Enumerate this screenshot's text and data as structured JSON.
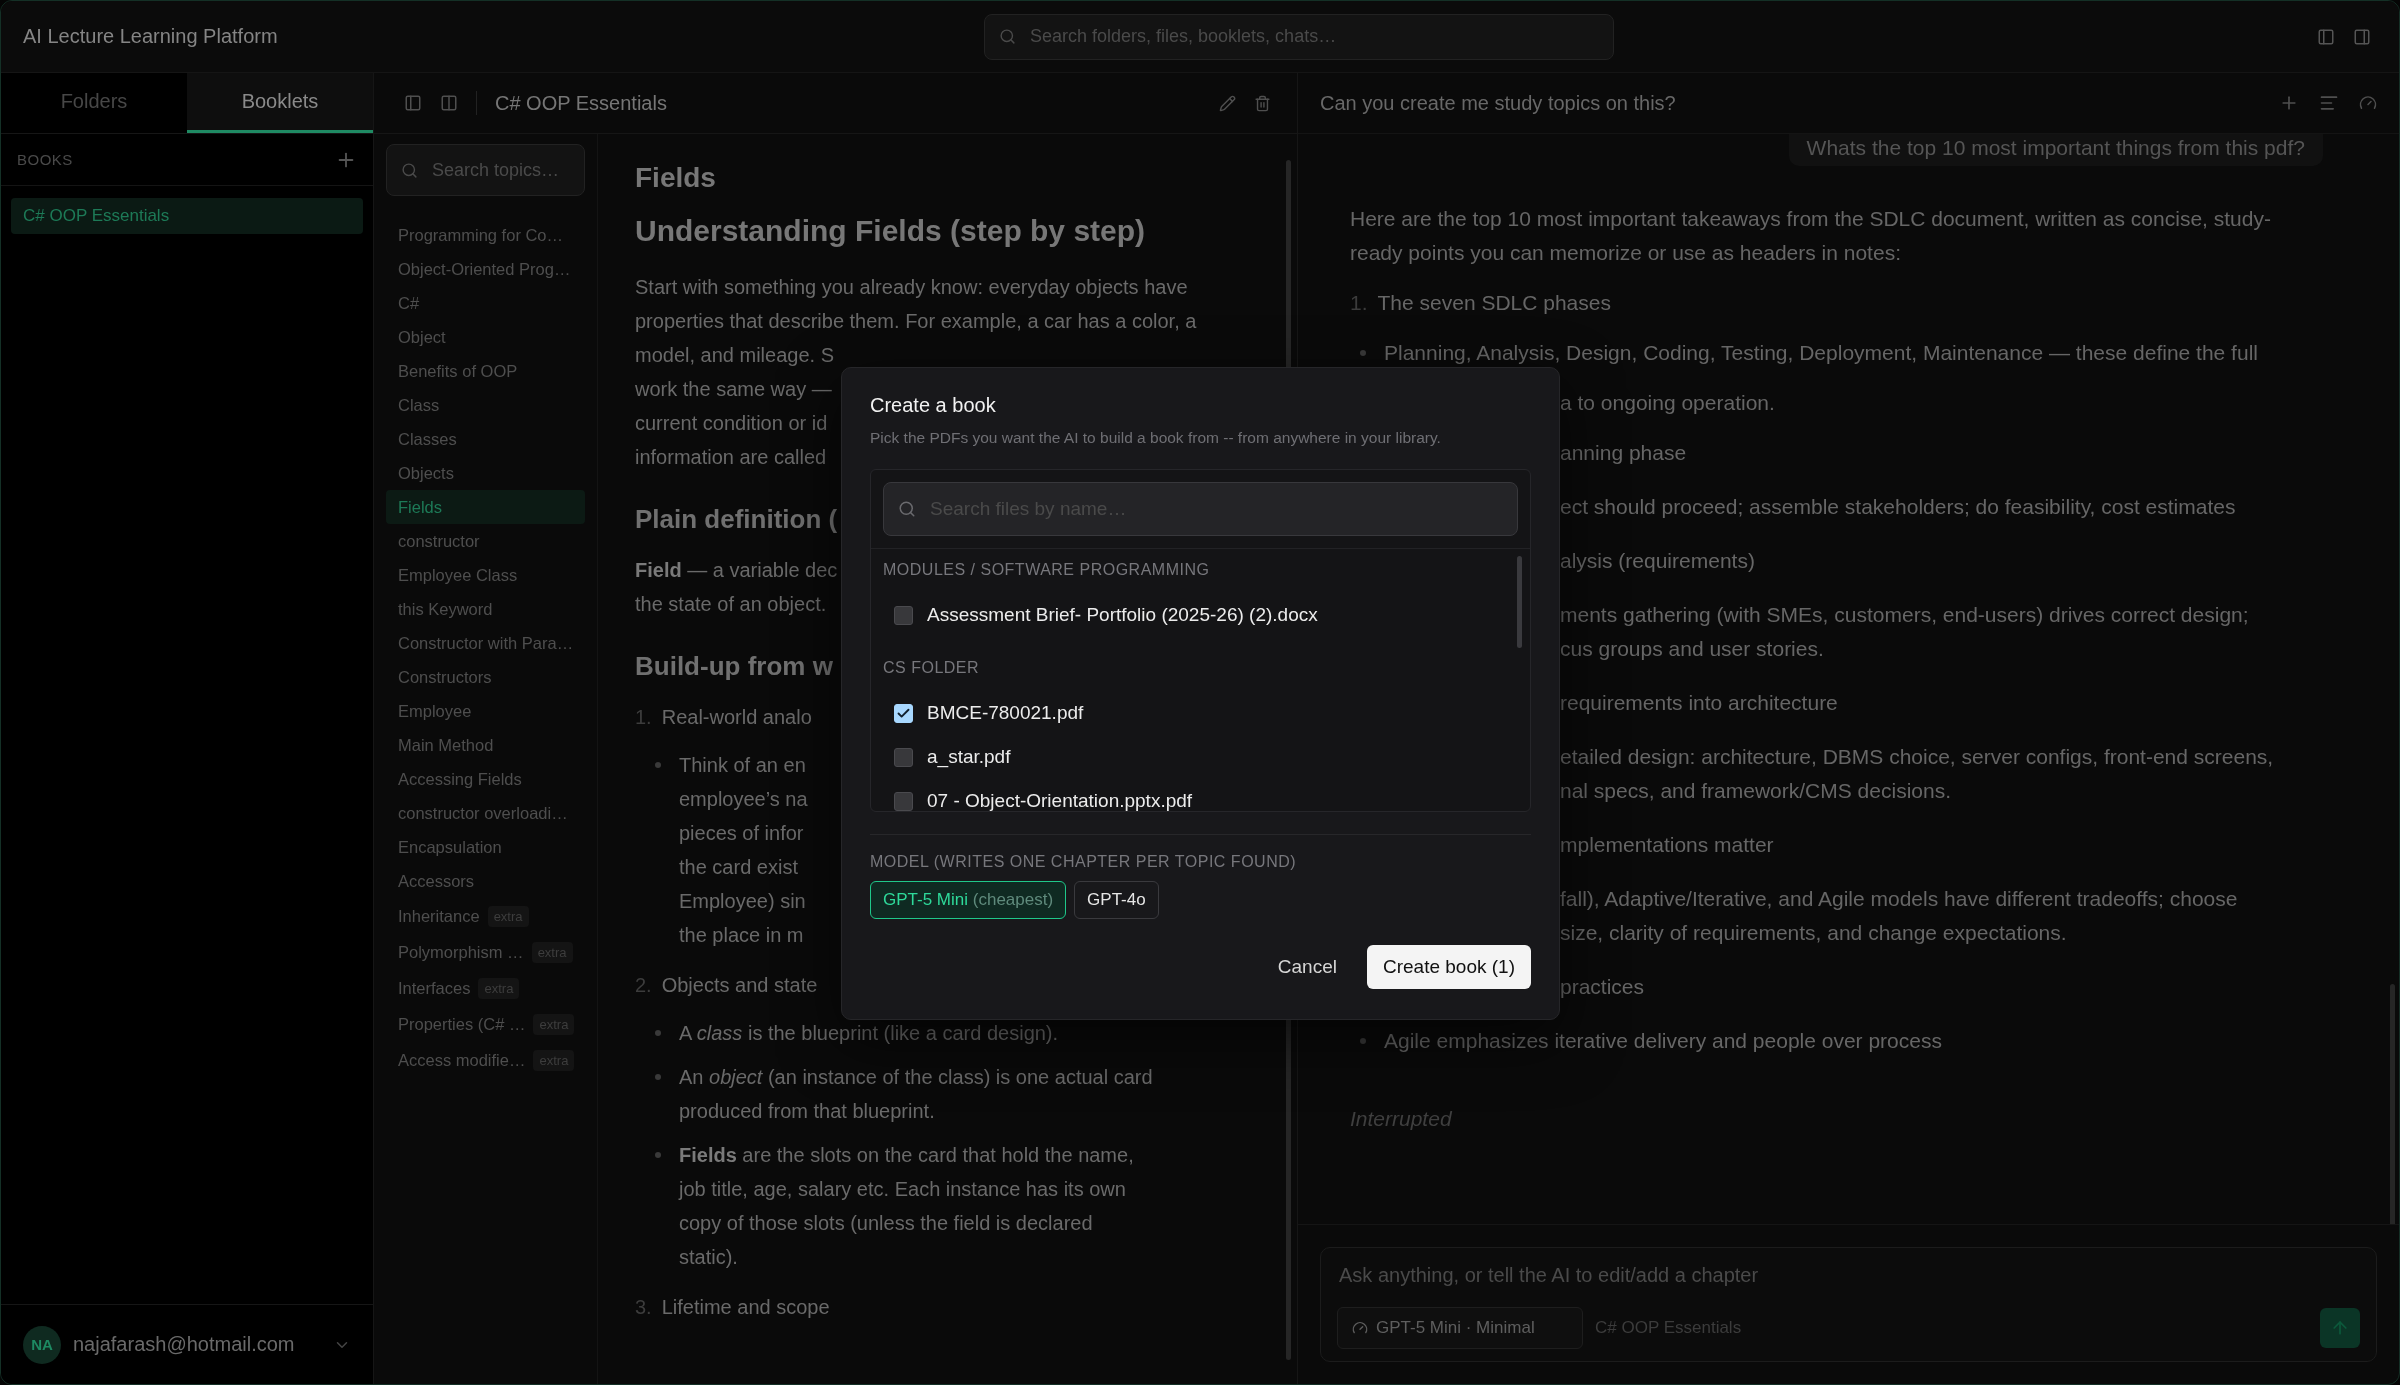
{
  "app": {
    "title": "AI Lecture Learning Platform",
    "search_placeholder": "Search folders, files, booklets, chats…"
  },
  "sidebar": {
    "tabs": [
      {
        "label": "Folders",
        "selected": false
      },
      {
        "label": "Booklets",
        "selected": true
      }
    ],
    "section": "BOOKS",
    "books": [
      {
        "title": "C# OOP Essentials",
        "selected": true
      }
    ],
    "user": {
      "initials": "NA",
      "email": "najafarash@hotmail.com"
    }
  },
  "booklet": {
    "title": "C# OOP Essentials",
    "topic_search_placeholder": "Search topics…",
    "topics": [
      {
        "label": "Programming for Co…",
        "selected": false
      },
      {
        "label": "Object-Oriented Prog…",
        "selected": false
      },
      {
        "label": "C#",
        "selected": false
      },
      {
        "label": "Object",
        "selected": false
      },
      {
        "label": "Benefits of OOP",
        "selected": false
      },
      {
        "label": "Class",
        "selected": false
      },
      {
        "label": "Classes",
        "selected": false
      },
      {
        "label": "Objects",
        "selected": false
      },
      {
        "label": "Fields",
        "selected": true
      },
      {
        "label": "constructor",
        "selected": false
      },
      {
        "label": "Employee Class",
        "selected": false
      },
      {
        "label": "this Keyword",
        "selected": false
      },
      {
        "label": "Constructor with Para…",
        "selected": false
      },
      {
        "label": "Constructors",
        "selected": false
      },
      {
        "label": "Employee",
        "selected": false
      },
      {
        "label": "Main Method",
        "selected": false
      },
      {
        "label": "Accessing Fields",
        "selected": false
      },
      {
        "label": "constructor overloadi…",
        "selected": false
      },
      {
        "label": "Encapsulation",
        "selected": false
      },
      {
        "label": "Accessors",
        "selected": false
      },
      {
        "label": "Inheritance",
        "selected": false,
        "badge": "extra"
      },
      {
        "label": "Polymorphism …",
        "selected": false,
        "badge": "extra"
      },
      {
        "label": "Interfaces",
        "selected": false,
        "badge": "extra"
      },
      {
        "label": "Properties (C# …",
        "selected": false,
        "badge": "extra"
      },
      {
        "label": "Access modifie…",
        "selected": false,
        "badge": "extra"
      }
    ],
    "blocks": [
      {
        "kind": "title",
        "text": "Fields"
      },
      {
        "kind": "h1",
        "text": "Understanding Fields (step by step)"
      },
      {
        "kind": "para",
        "lines": [
          "Start with something you already know: everyday objects have",
          "properties that describe them. For example, a car has a color, a"
        ]
      },
      {
        "kind": "para",
        "lines": [
          "model, and mileage. S",
          "work the same way —",
          "current condition or id",
          "information are called"
        ]
      },
      {
        "kind": "h2",
        "text": "Plain definition ("
      },
      {
        "kind": "para",
        "lines": [
          "**Field** — a variable dec",
          "the state of an object."
        ]
      },
      {
        "kind": "h2",
        "text": "Build-up from w"
      },
      {
        "kind": "item",
        "number": "1.",
        "text": "Real-world analo"
      },
      {
        "kind": "bullet",
        "lines": [
          "Think of an en",
          "employee’s na",
          "pieces of infor",
          "the card exist",
          "Employee) sin",
          "the place in m"
        ]
      },
      {
        "kind": "item",
        "number": "2.",
        "text": "Objects and state"
      },
      {
        "kind": "bullet",
        "lines": [
          "A *class* is the blueprint (like a card design)."
        ]
      },
      {
        "kind": "bullet",
        "lines": [
          "An *object* (an instance of the class) is one actual card",
          "produced from that blueprint."
        ]
      },
      {
        "kind": "bullet",
        "lines": [
          "**Fields** are the slots on the card that hold the name,",
          "job title, age, salary etc. Each instance has its own",
          "copy of those slots (unless the field is declared",
          "static)."
        ]
      },
      {
        "kind": "item",
        "number": "3.",
        "text": "Lifetime and scope"
      }
    ]
  },
  "chat": {
    "title": "Can you create me study topics on this?",
    "messages": [
      {
        "kind": "user",
        "lines": [
          "Whats the top 10 most important things from this pdf?"
        ]
      },
      {
        "kind": "para",
        "lines": [
          "Here are the top 10 most important takeaways from the SDLC document, written as concise, study-",
          "ready points you can memorize or use as headers in notes:"
        ]
      },
      {
        "kind": "item",
        "number": "1.",
        "lines": [
          "The seven SDLC phases"
        ]
      },
      {
        "kind": "bullet",
        "lines": [
          "Planning, Analysis, Design, Coding, Testing, Deployment, Maintenance — these define the full"
        ]
      },
      {
        "kind": "wrap",
        "lines": [
          "a to ongoing operation."
        ]
      },
      {
        "kind": "fragment",
        "lines": [
          "anning phase"
        ]
      },
      {
        "kind": "fragment",
        "lines": [
          "ect should proceed; assemble stakeholders; do feasibility, cost estimates"
        ]
      },
      {
        "kind": "fragment",
        "lines": [
          "alysis (requirements)"
        ]
      },
      {
        "kind": "fragment",
        "lines": [
          "ments gathering (with SMEs, customers, end-users) drives correct design;",
          "cus groups and user stories."
        ]
      },
      {
        "kind": "fragment",
        "lines": [
          "requirements into architecture"
        ]
      },
      {
        "kind": "fragment",
        "lines": [
          "etailed design: architecture, DBMS choice, server configs, front-end screens,",
          "nal specs, and framework/CMS decisions."
        ]
      },
      {
        "kind": "fragment",
        "lines": [
          "mplementations matter"
        ]
      },
      {
        "kind": "fragment",
        "lines": [
          "fall), Adaptive/Iterative, and Agile models have different tradeoffs; choose",
          "size, clarity of requirements, and change expectations."
        ]
      },
      {
        "kind": "fragment",
        "lines": [
          "practices"
        ]
      },
      {
        "kind": "bullet",
        "lines": [
          "Agile emphasizes iterative delivery and people over process"
        ]
      },
      {
        "kind": "note",
        "lines": [
          "Interrupted"
        ]
      }
    ],
    "input_placeholder": "Ask anything, or tell the AI to edit/add a chapter",
    "model": "GPT-5 Mini · Minimal",
    "context": "C# OOP Essentials"
  },
  "modal": {
    "title": "Create a book",
    "description": "Pick the PDFs you want the AI to build a book from -- from anywhere in your library.",
    "search_placeholder": "Search files by name…",
    "groups": [
      {
        "name": "MODULES / SOFTWARE PROGRAMMING",
        "files": [
          {
            "name": "Assessment Brief- Portfolio (2025-26) (2).docx",
            "checked": false
          }
        ]
      },
      {
        "name": "CS FOLDER",
        "files": [
          {
            "name": "BMCE-780021.pdf",
            "checked": true
          },
          {
            "name": "a_star.pdf",
            "checked": false
          },
          {
            "name": "07 - Object-Orientation.pptx.pdf",
            "checked": false
          }
        ]
      }
    ],
    "model_label": "MODEL (WRITES ONE CHAPTER PER TOPIC FOUND)",
    "models": [
      {
        "name": "GPT-5 Mini",
        "note": "(cheapest)",
        "selected": true
      },
      {
        "name": "GPT-4o",
        "selected": false
      }
    ],
    "cancel": "Cancel",
    "confirm": "Create book (1)"
  }
}
